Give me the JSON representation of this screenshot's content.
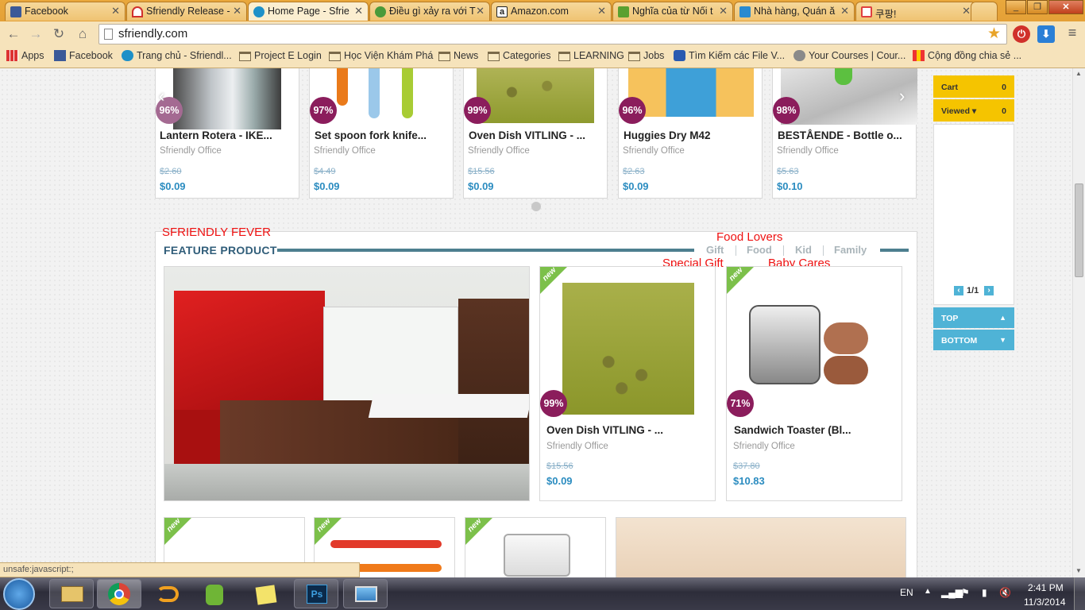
{
  "browser": {
    "tabs": [
      {
        "label": "Facebook",
        "color": "#3b5998",
        "icon": "facebook-icon"
      },
      {
        "label": "Sfriendly Release -",
        "color": "#d0312d",
        "icon": "arc-icon"
      },
      {
        "label": "Home Page - Sfrie",
        "color": "#1e90c8",
        "icon": "s-logo-icon"
      },
      {
        "label": "Điều gì xảy ra với T",
        "color": "#4a9a3a",
        "icon": "leaf-icon"
      },
      {
        "label": "Amazon.com",
        "color": "#222222",
        "icon": "amazon-icon"
      },
      {
        "label": "Nghĩa của từ Nối t",
        "color": "#5aa030",
        "icon": "puzzle-icon"
      },
      {
        "label": "Nhà hàng, Quán ă",
        "color": "#2a8ad0",
        "icon": "people-icon"
      },
      {
        "label": "쿠팡!",
        "color": "#e04040",
        "icon": "coupang-icon"
      }
    ],
    "url": "sfriendly.com",
    "bookmarks": [
      {
        "label": "Apps",
        "icon": "apps-grid-icon"
      },
      {
        "label": "Facebook",
        "icon": "facebook-icon"
      },
      {
        "label": "Trang chủ - Sfriendl...",
        "icon": "s-logo-icon"
      },
      {
        "label": "Project E Login",
        "icon": "folder-icon"
      },
      {
        "label": "Học Viện Khám Phá",
        "icon": "folder-icon"
      },
      {
        "label": "News",
        "icon": "folder-icon"
      },
      {
        "label": "Categories",
        "icon": "folder-icon"
      },
      {
        "label": "LEARNING",
        "icon": "folder-icon"
      },
      {
        "label": "Jobs",
        "icon": "folder-icon"
      },
      {
        "label": "Tìm Kiếm các File V...",
        "icon": "search-icon"
      },
      {
        "label": "Your Courses | Cour...",
        "icon": "globe-icon"
      },
      {
        "label": "Cộng đồng chia sẻ ...",
        "icon": "bars-icon"
      }
    ],
    "status_text": "unsafe:javascript:;"
  },
  "carousel": {
    "products": [
      {
        "name": "Lantern Rotera - IKE...",
        "vendor": "Sfriendly Office",
        "old_price": "$2.60",
        "price": "$0.09",
        "discount": "96%"
      },
      {
        "name": "Set spoon fork knife...",
        "vendor": "Sfriendly Office",
        "old_price": "$4.49",
        "price": "$0.09",
        "discount": "97%"
      },
      {
        "name": "Oven Dish VITLING - ...",
        "vendor": "Sfriendly Office",
        "old_price": "$15.56",
        "price": "$0.09",
        "discount": "99%"
      },
      {
        "name": "Huggies Dry M42",
        "vendor": "Sfriendly Office",
        "old_price": "$2.63",
        "price": "$0.09",
        "discount": "96%"
      },
      {
        "name": "BESTÅENDE - Bottle o...",
        "vendor": "Sfriendly Office",
        "old_price": "$5.63",
        "price": "$0.10",
        "discount": "98%"
      }
    ]
  },
  "feature": {
    "fever_label": "SFRIENDLY FEVER",
    "title": "FEATURE PRODUCT",
    "tabs": [
      "Gift",
      "Food",
      "Kid",
      "Family"
    ],
    "annotations": {
      "food_lovers": "Food Lovers",
      "special_gift": "Special Gift",
      "baby_cares": "Baby Cares"
    },
    "new_label": "new",
    "products": [
      {
        "name": "Oven Dish VITLING - ...",
        "vendor": "Sfriendly Office",
        "old_price": "$15.56",
        "price": "$0.09",
        "discount": "99%"
      },
      {
        "name": "Sandwich Toaster (Bl...",
        "vendor": "Sfriendly Office",
        "old_price": "$37.80",
        "price": "$10.83",
        "discount": "71%"
      }
    ]
  },
  "sidebar": {
    "cart_label": "Cart",
    "cart_count": "0",
    "viewed_label": "Viewed",
    "viewed_count": "0",
    "pager": "1/1",
    "top_label": "TOP",
    "bottom_label": "BOTTOM"
  },
  "taskbar": {
    "language": "EN",
    "time": "2:41 PM",
    "date": "11/3/2014",
    "apps": [
      "windows-explorer-icon",
      "chrome-icon",
      "network-icon",
      "evernote-icon",
      "sticky-notes-icon",
      "photoshop-icon",
      "image-viewer-icon"
    ]
  },
  "colors": {
    "accent_yellow": "#f5c400",
    "accent_blue": "#4fb3d6",
    "discount_badge": "#8b1d5c",
    "price_blue": "#2b8cc0",
    "annotation_red": "#ee1111"
  }
}
